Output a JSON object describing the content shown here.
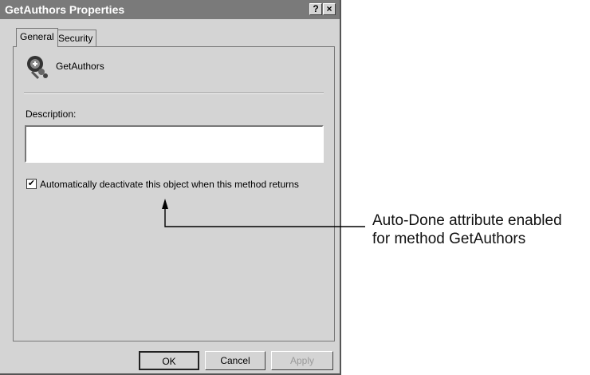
{
  "dialog": {
    "title": "GetAuthors Properties",
    "help_btn": "?",
    "close_btn": "×",
    "tabs": [
      {
        "label": "General",
        "active": true
      },
      {
        "label": "Security",
        "active": false
      }
    ],
    "object_name": "GetAuthors",
    "object_icon": "component-method-icon",
    "description_label": "Description:",
    "description_value": "",
    "auto_done": {
      "checked": true,
      "check_mark": "✔",
      "label": "Automatically deactivate this object when this method returns"
    },
    "buttons": {
      "ok": "OK",
      "cancel": "Cancel",
      "apply": "Apply"
    }
  },
  "callout": {
    "line1": "Auto-Done attribute enabled",
    "line2": "for method GetAuthors"
  }
}
